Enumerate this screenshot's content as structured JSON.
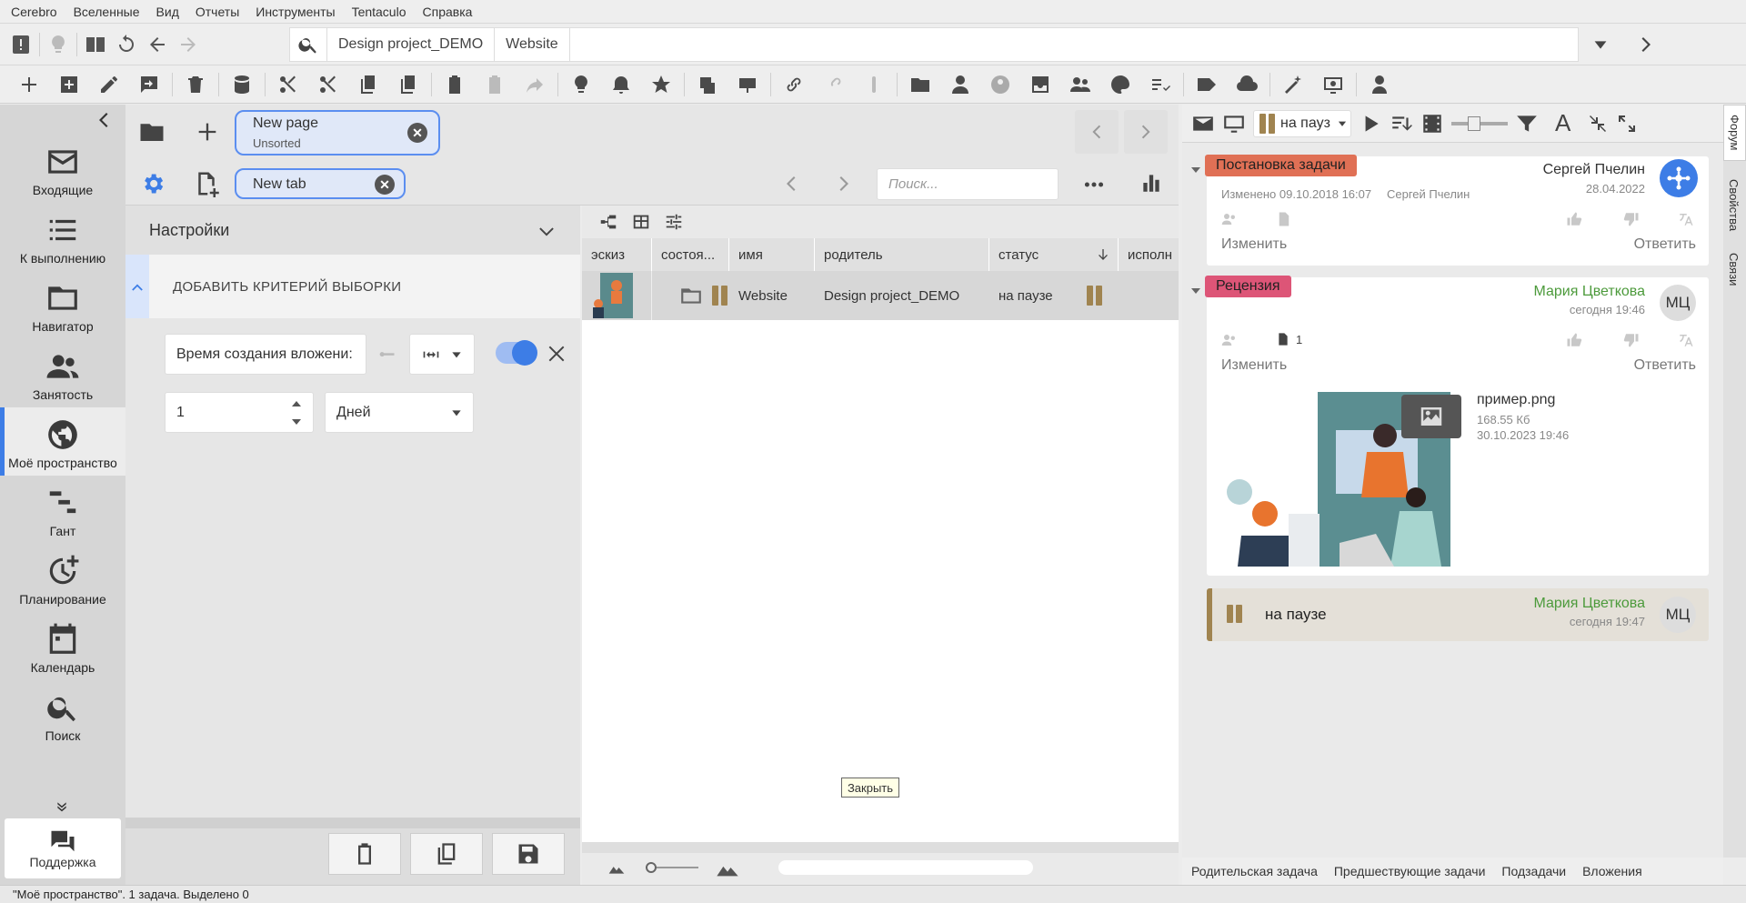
{
  "menubar": [
    "Cerebro",
    "Вселенные",
    "Вид",
    "Отчеты",
    "Инструменты",
    "Tentaculo",
    "Справка"
  ],
  "breadcrumb": [
    "Design project_DEMO",
    "Website"
  ],
  "sidebar": {
    "items": [
      {
        "label": "Входящие",
        "icon": "mail-icon"
      },
      {
        "label": "К выполнению",
        "icon": "list-icon"
      },
      {
        "label": "Навигатор",
        "icon": "folder-icon"
      },
      {
        "label": "Занятость",
        "icon": "people-icon"
      },
      {
        "label": "Моё пространство",
        "icon": "globe-icon",
        "active": true
      },
      {
        "label": "Гант",
        "icon": "gantt-icon"
      },
      {
        "label": "Планирование",
        "icon": "clock-plus-icon"
      },
      {
        "label": "Календарь",
        "icon": "calendar-icon"
      },
      {
        "label": "Поиск",
        "icon": "search-icon"
      }
    ],
    "support": "Поддержка"
  },
  "page_tab": {
    "title": "New page",
    "subtitle": "Unsorted"
  },
  "sub_tab": {
    "title": "New tab"
  },
  "search": {
    "placeholder": "Поиск..."
  },
  "settings": {
    "title": "Настройки",
    "add_criteria": "ДОБАВИТЬ КРИТЕРИЙ ВЫБОРКИ",
    "field": "Время создания вложени:",
    "number": "1",
    "unit": "Дней"
  },
  "grid": {
    "columns": [
      "эскиз",
      "состоя...",
      "имя",
      "родитель",
      "статус",
      "исполн"
    ],
    "rows": [
      {
        "name": "Website",
        "parent": "Design project_DEMO",
        "status": "на паузе"
      }
    ]
  },
  "tooltip": "Закрыть",
  "right_toolbar": {
    "status_select": "на пауз"
  },
  "right_tabs": [
    "Форум",
    "Свойства",
    "Связи"
  ],
  "forum": {
    "card1": {
      "badge": "Постановка задачи",
      "badge_color": "#e06a4e",
      "author": "Сергей Пчелин",
      "date": "28.04.2022",
      "changed": "Изменено 09.10.2018 16:07",
      "changed_by": "Сергей Пчелин",
      "edit": "Изменить",
      "reply": "Ответить"
    },
    "card2": {
      "badge": "Рецензия",
      "badge_color": "#d94f6e",
      "author": "Мария Цветкова",
      "date": "сегодня 19:46",
      "avatar": "МЦ",
      "attach_count": "1",
      "edit": "Изменить",
      "reply": "Ответить",
      "file_name": "пример.png",
      "file_size": "168.55 Кб",
      "file_date": "30.10.2023 19:46"
    },
    "card3": {
      "status": "на паузе",
      "author": "Мария Цветкова",
      "date": "сегодня 19:47",
      "avatar": "МЦ"
    }
  },
  "bottom_tabs": [
    "Родительская задача",
    "Предшествующие задачи",
    "Подзадачи",
    "Вложения"
  ],
  "status_bar": "\"Моё пространство\". 1 задача. Выделено 0"
}
